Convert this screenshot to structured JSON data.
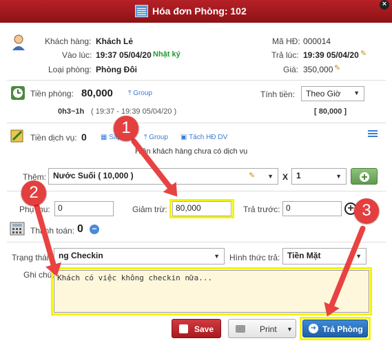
{
  "title": "Hóa đơn Phòng: 102",
  "customer": {
    "label": "Khách hàng:",
    "value": "Khách Lẻ"
  },
  "checkin": {
    "label": "Vào lúc:",
    "value": "19:37 05/04/20",
    "log_link": "Nhật ký"
  },
  "room_type": {
    "label": "Loại phòng:",
    "value": "Phòng Đôi"
  },
  "invoice_id": {
    "label": "Mã HĐ:",
    "value": "000014"
  },
  "checkout": {
    "label": "Trả lúc:",
    "value": "19:39 05/04/20"
  },
  "price": {
    "label": "Giá:",
    "value": "350,000"
  },
  "room_fee": {
    "label": "Tiền phòng:",
    "value": "80,000",
    "group_link": "Group",
    "calc_label": "Tính tiền:",
    "calc_mode": "Theo Giờ",
    "duration": "0h3~1h",
    "range": "( 19:37 - 19:39 05/04/20 )",
    "subtotal": "[ 80,000 ]"
  },
  "service_fee": {
    "label": "Tiền dịch vụ:",
    "value": "0",
    "sort_link": "Sắp",
    "group_link": "Group",
    "split_link": "Tách HĐ DV",
    "empty_msg": "Hiện khách hàng chưa có dịch vụ"
  },
  "add_service": {
    "label": "Thêm:",
    "product": "Nước Suối ( 10,000 )",
    "x": "X",
    "qty": "1"
  },
  "surcharge": {
    "label": "Phụ thu:",
    "value": "0"
  },
  "discount": {
    "label": "Giảm trừ:",
    "value": "80,000"
  },
  "prepaid": {
    "label": "Trả trước:",
    "value": "0"
  },
  "payment": {
    "label": "Thanh toán:",
    "value": "0"
  },
  "status": {
    "label": "Trạng thái:",
    "value": "ng Checkin"
  },
  "pay_method": {
    "label": "Hình thức trả:",
    "value": "Tiền Mặt"
  },
  "note": {
    "label": "Ghi chú:",
    "value": "Khách có việc không checkin nữa..."
  },
  "buttons": {
    "save": "Save",
    "print": "Print",
    "checkout": "Trả Phòng"
  },
  "badges": {
    "b1": "1",
    "b2": "2",
    "b3": "3"
  },
  "colors": {
    "title_bar": "#a11a1f",
    "highlight": "#f3f30a",
    "annotation": "#e43f3f",
    "checkout_btn": "#2b73c4",
    "save_btn": "#c0282e"
  }
}
